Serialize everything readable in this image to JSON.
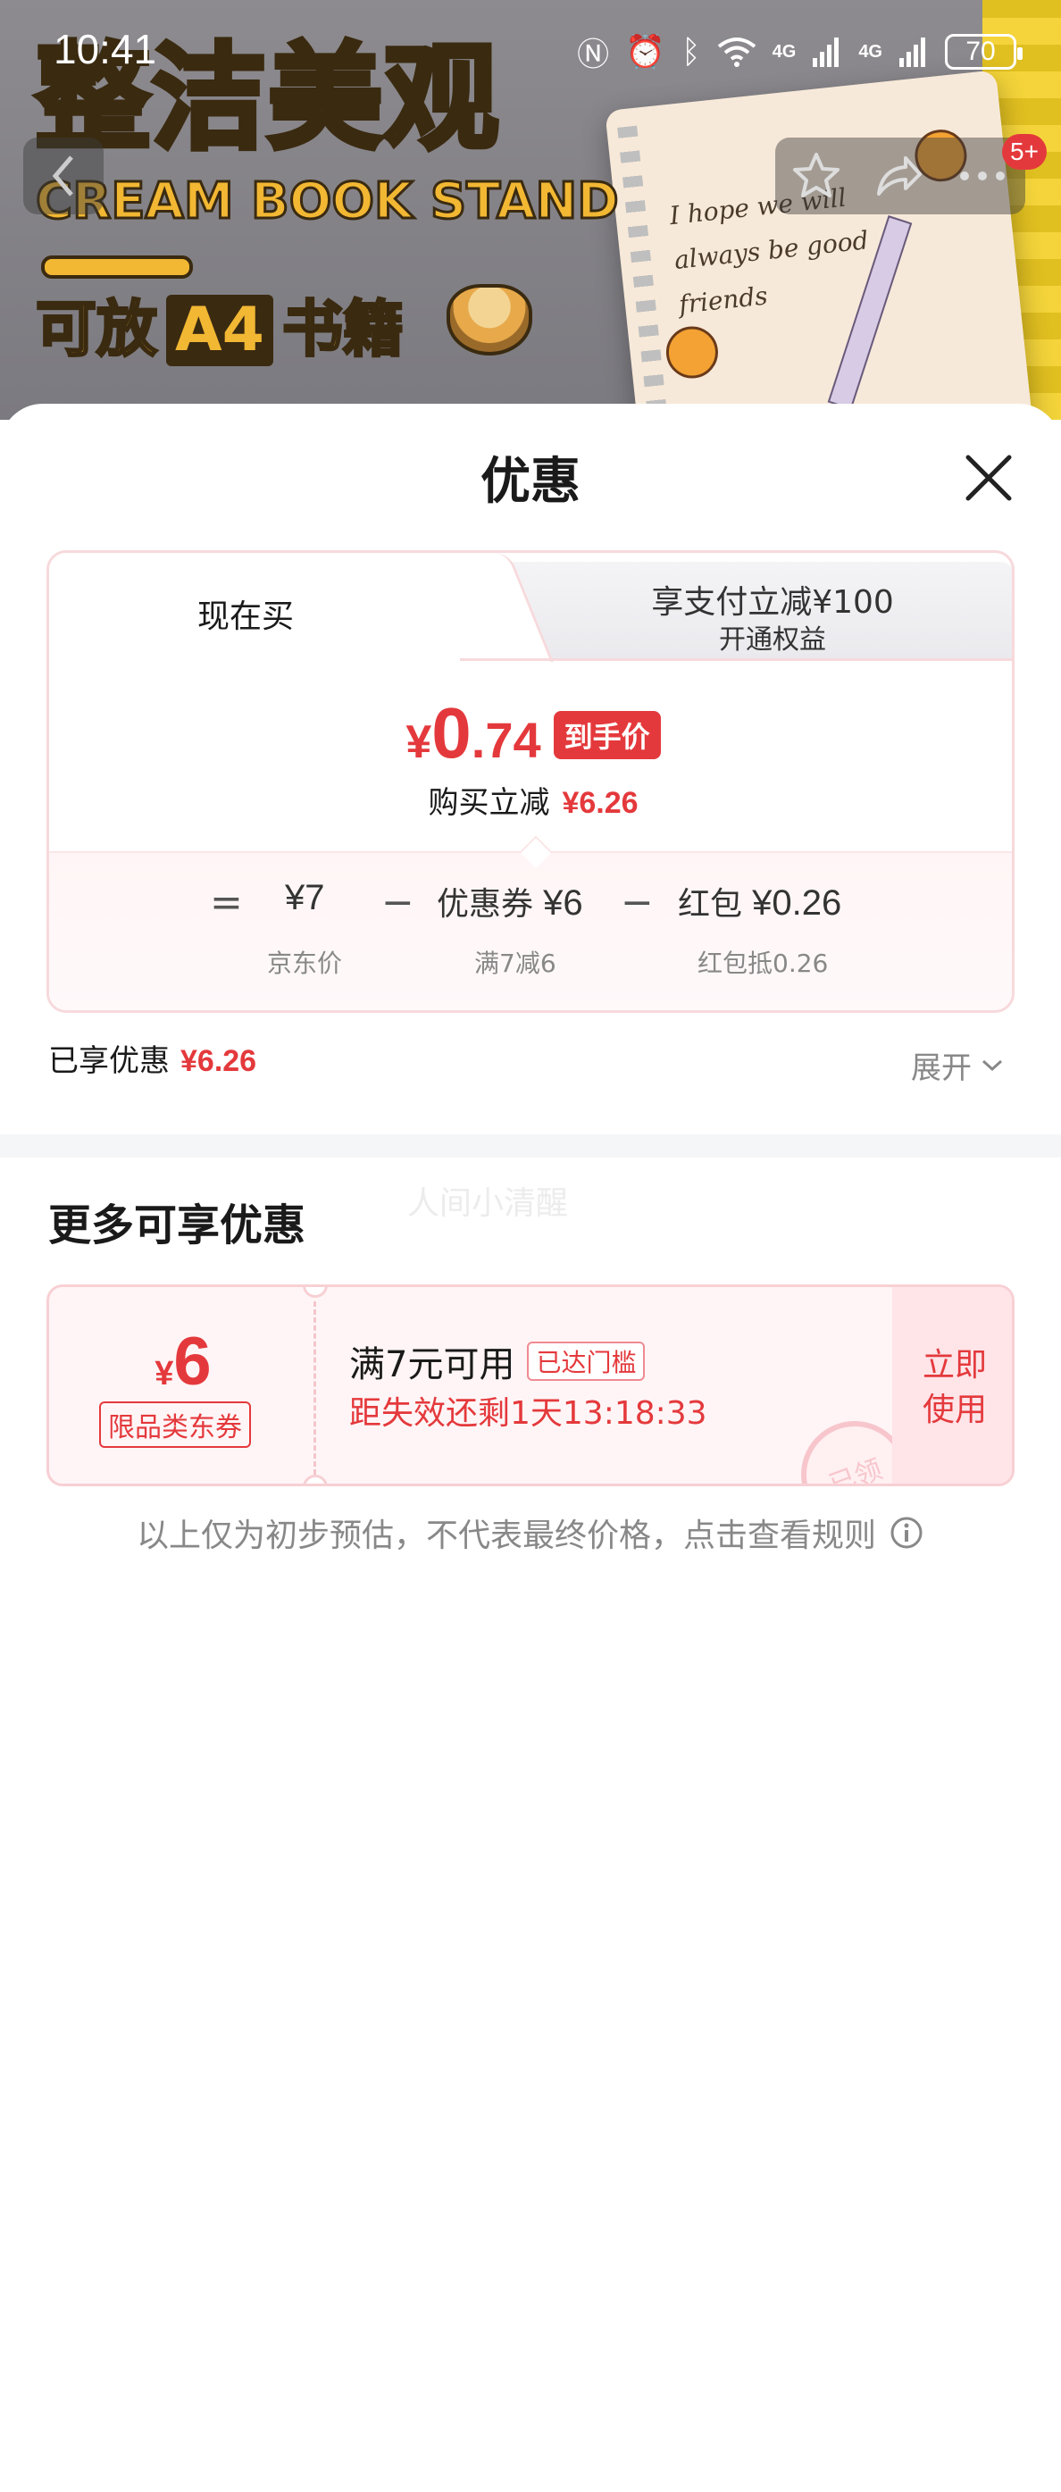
{
  "status_bar": {
    "time": "10:41",
    "battery": "70",
    "net1": "4G",
    "net2": "4G"
  },
  "banner": {
    "headline": "整洁美观",
    "subtitle_en": "CREAM BOOK STAND",
    "sub_prefix": "可放",
    "sub_box": "A4",
    "sub_suffix": "书籍",
    "notebook_lines": [
      "I hope we will",
      "always be good",
      "friends"
    ]
  },
  "nav": {
    "cart_badge": "5+"
  },
  "sheet": {
    "title": "优惠",
    "tabs": {
      "now": "现在买",
      "pay_title": "享支付立减¥100",
      "pay_sub": "开通权益"
    },
    "final": {
      "currency": "¥",
      "integer": "0",
      "decimal": ".74",
      "tag": "到手价",
      "reduce_label": "购买立减",
      "reduce_amount": "¥6.26"
    },
    "breakdown": {
      "eq": "=",
      "jd_price": "¥7",
      "jd_label": "京东价",
      "minus1": "−",
      "coupon_label": "优惠券",
      "coupon_value": "¥6",
      "coupon_sub": "满7减6",
      "minus2": "−",
      "redpack_label": "红包",
      "redpack_value": "¥0.26",
      "redpack_sub": "红包抵0.26"
    },
    "enjoyed_label": "已享优惠",
    "enjoyed_amount": "¥6.26",
    "expand_label": "展开",
    "watermark": "人间小清醒",
    "more_title": "更多可享优惠",
    "coupon": {
      "currency": "¥",
      "amount": "6",
      "type": "限品类东券",
      "condition": "满7元可用",
      "badge": "已达门槛",
      "expire": "距失效还剩1天13:18:33",
      "use_line1": "立即",
      "use_line2": "使用",
      "stamp": "已领"
    },
    "disclaimer": "以上仅为初步预估，不代表最终价格，点击查看规则"
  }
}
